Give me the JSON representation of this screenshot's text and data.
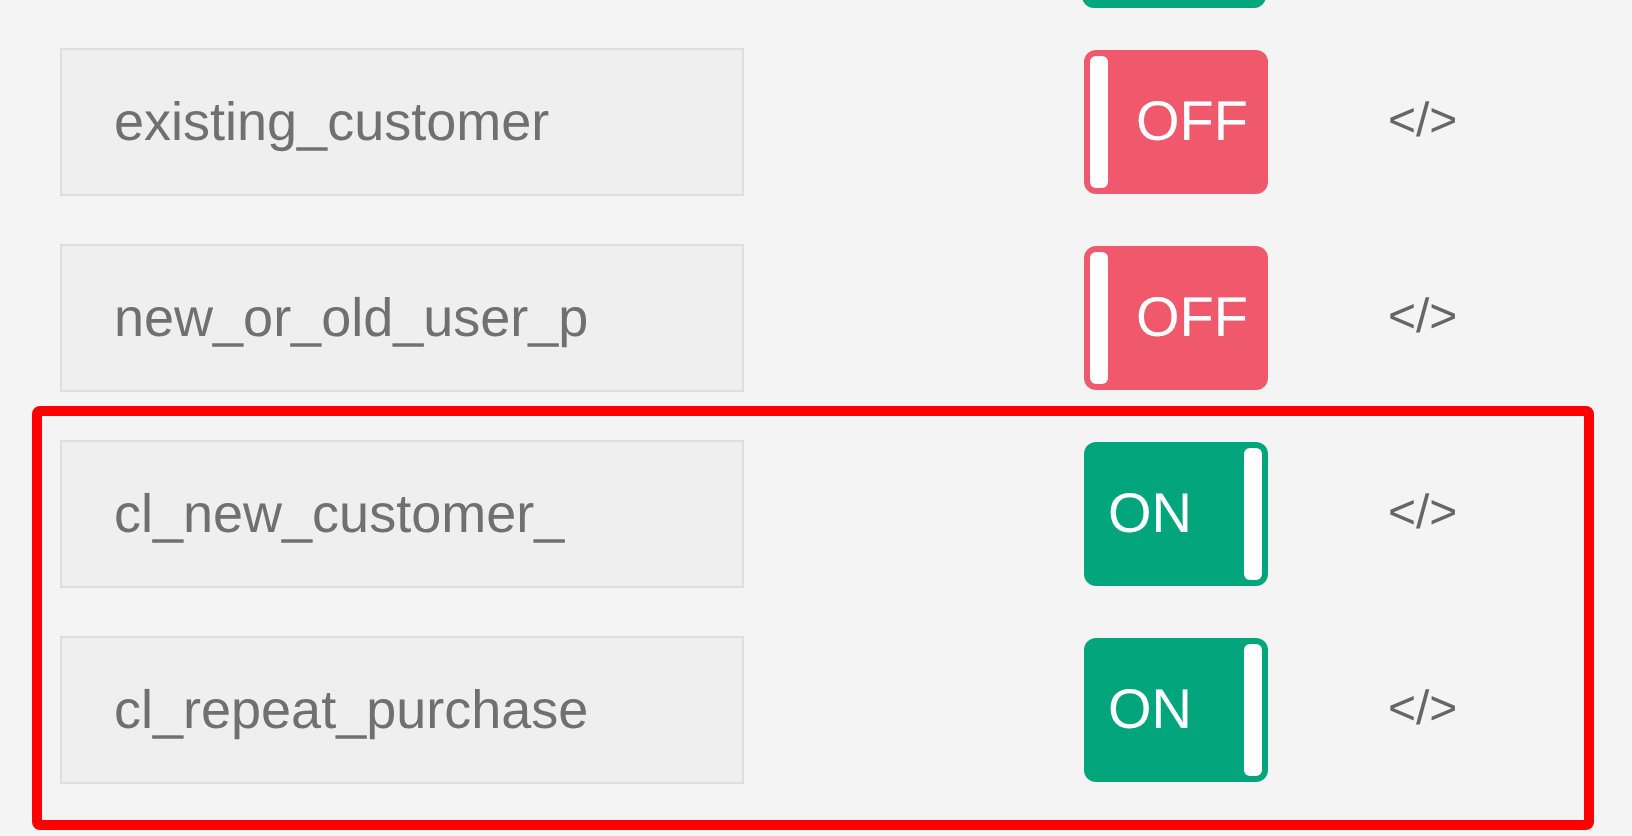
{
  "partial_toggle": {
    "on": true
  },
  "rows": [
    {
      "name": "existing_customer",
      "on": false,
      "toggle_label": "OFF",
      "code": "</>"
    },
    {
      "name": "new_or_old_user_p",
      "on": false,
      "toggle_label": "OFF",
      "code": "</>"
    }
  ],
  "highlighted_rows": [
    {
      "name": "cl_new_customer_",
      "on": true,
      "toggle_label": "ON",
      "code": "</>"
    },
    {
      "name": "cl_repeat_purchase",
      "on": true,
      "toggle_label": "ON",
      "code": "</>"
    }
  ]
}
